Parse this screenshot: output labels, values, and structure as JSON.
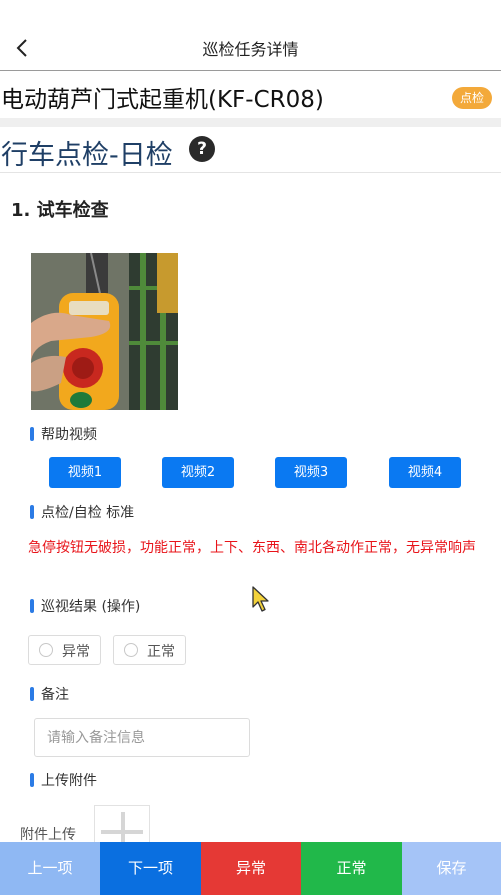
{
  "header": {
    "title": "巡检任务详情"
  },
  "device": {
    "name": "电动葫芦门式起重机(KF-CR08)",
    "badge": "点检"
  },
  "task": {
    "title": "行车点检-日检",
    "help_glyph": "?"
  },
  "item": {
    "title": "1. 试车检查"
  },
  "help_video": {
    "label": "帮助视频",
    "buttons": [
      "视频1",
      "视频2",
      "视频3",
      "视频4"
    ]
  },
  "standard": {
    "label": "点检/自检 标准",
    "text": "急停按钮无破损，功能正常，上下、东西、南北各动作正常，无异常响声"
  },
  "result": {
    "label": "巡视结果 (操作)",
    "options": [
      "异常",
      "正常"
    ]
  },
  "remark": {
    "label": "备注",
    "placeholder": "请输入备注信息"
  },
  "attachment": {
    "label": "上传附件",
    "upload_label": "附件上传"
  },
  "footer": {
    "prev": "上一项",
    "next": "下一项",
    "abnormal": "异常",
    "normal": "正常",
    "save": "保存"
  },
  "colors": {
    "accent_blue": "#0a79f2",
    "badge_orange": "#f3a93a",
    "standard_red": "#e8141a",
    "prev_bg": "#8fb8f3",
    "next_bg": "#0a6fe0",
    "abnormal_bg": "#e53935",
    "normal_bg": "#21b84a",
    "save_bg": "#a5c4f7"
  }
}
